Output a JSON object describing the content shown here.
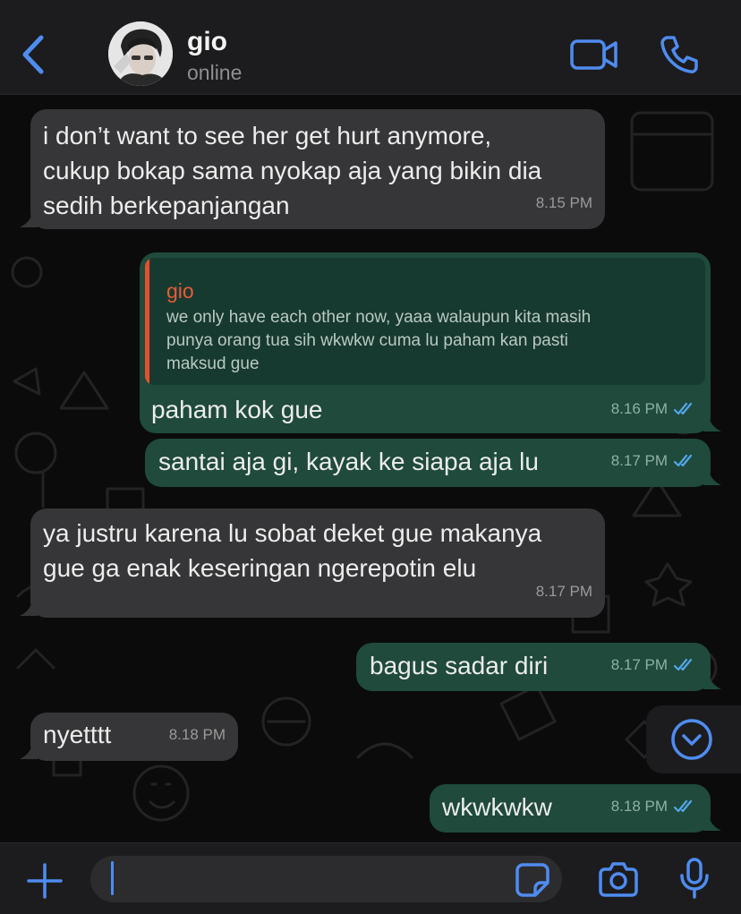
{
  "header": {
    "contact_name": "gio",
    "status": "online"
  },
  "messages": [
    {
      "direction": "incoming",
      "text_lines": [
        "i don’t want to see her get hurt anymore,",
        "cukup bokap sama nyokap aja yang bikin dia",
        "sedih berkepanjangan"
      ],
      "time": "8.15 PM"
    },
    {
      "direction": "outgoing",
      "reply_to": {
        "author": "gio",
        "text_lines": [
          "we only have each other now, yaaa walaupun kita masih",
          "punya orang tua sih wkwkw cuma lu paham kan pasti",
          "maksud gue"
        ]
      },
      "text": "paham kok gue",
      "time": "8.16 PM",
      "read": true
    },
    {
      "direction": "outgoing",
      "text": "santai aja gi, kayak ke siapa aja lu",
      "time": "8.17 PM",
      "read": true
    },
    {
      "direction": "incoming",
      "text_lines": [
        "ya justru karena lu sobat deket gue makanya",
        "gue ga enak keseringan ngerepotin elu"
      ],
      "time": "8.17 PM"
    },
    {
      "direction": "outgoing",
      "text": "bagus sadar diri",
      "time": "8.17 PM",
      "read": true
    },
    {
      "direction": "incoming",
      "text": "nyetttt",
      "time": "8.18 PM"
    },
    {
      "direction": "outgoing",
      "text": "wkwkwkw",
      "time": "8.18 PM",
      "read": true
    }
  ],
  "composer": {
    "value": ""
  },
  "icons": {
    "back": "chevron-left-icon",
    "video": "video-camera-icon",
    "call": "phone-icon",
    "scroll_down": "chevron-down-circle-icon",
    "attach": "plus-icon",
    "sticker": "sticker-icon",
    "camera": "camera-icon",
    "mic": "microphone-icon",
    "read_receipt": "double-check-icon"
  },
  "colors": {
    "accent": "#4f8cf0",
    "incoming_bubble": "#363638",
    "outgoing_bubble": "#1f4a3c",
    "quote_author": "#e85b36",
    "read_tick": "#53a6e8"
  }
}
